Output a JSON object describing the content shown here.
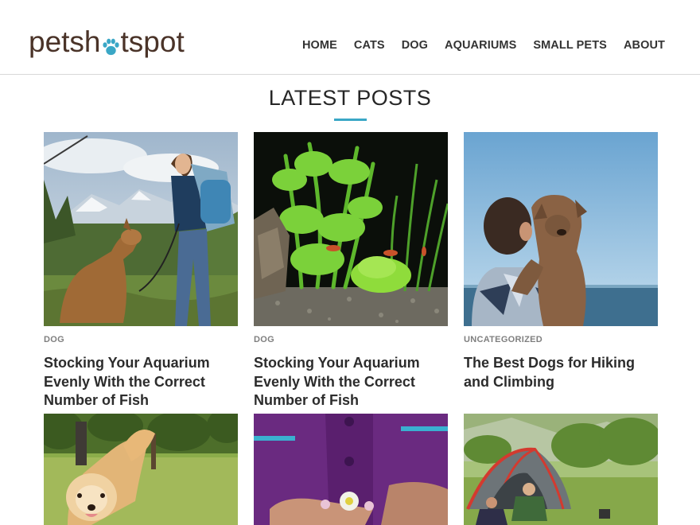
{
  "site": {
    "logo_text_left": "petsh",
    "logo_text_right": "tspot",
    "logo_paw_icon": "paw-icon",
    "logo_color": "#4a3328",
    "paw_color": "#3aa7c6"
  },
  "nav": {
    "items": [
      {
        "label": "HOME"
      },
      {
        "label": "CATS"
      },
      {
        "label": "DOG"
      },
      {
        "label": "AQUARIUMS"
      },
      {
        "label": "SMALL PETS"
      },
      {
        "label": "ABOUT"
      }
    ]
  },
  "main": {
    "section_title": "LATEST POSTS",
    "accent_color": "#3aa7c6",
    "posts": [
      {
        "category": "DOG",
        "title": "Stocking Your Aquarium Evenly With the Correct Number of Fish",
        "image": "woman hiking with dog"
      },
      {
        "category": "DOG",
        "title": "Stocking Your Aquarium Evenly With the Correct Number of Fish",
        "image": "aquarium plants and fish"
      },
      {
        "category": "UNCATEGORIZED",
        "title": "The Best Dogs for Hiking and Climbing",
        "image": "man hugging dog by sea"
      }
    ],
    "bottom_images": [
      {
        "image": "golden retriever in park"
      },
      {
        "image": "purple uniform holding flower"
      },
      {
        "image": "camping tent in meadow"
      }
    ]
  }
}
